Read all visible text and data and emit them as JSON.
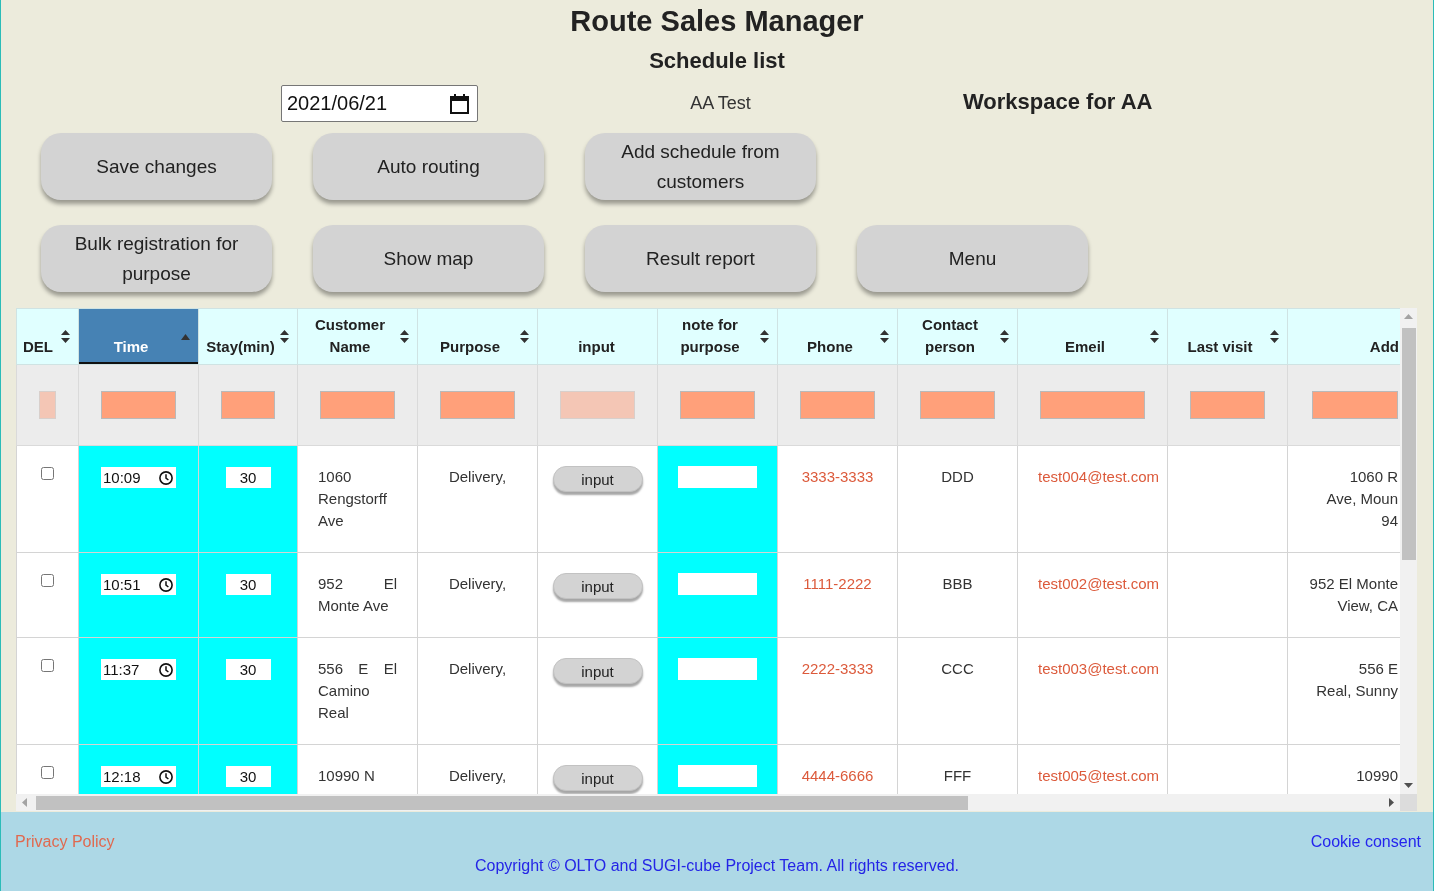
{
  "header": {
    "title": "Route Sales Manager",
    "subtitle": "Schedule list",
    "date_field": {
      "value": "2021/06/21"
    },
    "user": "AA Test",
    "workspace": "Workspace for AA"
  },
  "button_rows": [
    [
      "Save changes",
      "Auto routing",
      "Add schedule from customers"
    ],
    [
      "Bulk registration for purpose",
      "Show map",
      "Result report",
      "Menu"
    ]
  ],
  "table": {
    "columns": [
      {
        "kind": "del",
        "label": "DEL",
        "sortable": true,
        "sorted_ascending": false,
        "editable": false,
        "filter_disabled": true
      },
      {
        "kind": "time",
        "label": "Time",
        "sortable": true,
        "sorted_ascending": true,
        "editable": true,
        "filter_disabled": false
      },
      {
        "kind": "stay",
        "label": "Stay(min)",
        "sortable": true,
        "sorted_ascending": false,
        "editable": true,
        "filter_disabled": false
      },
      {
        "kind": "customer",
        "label": "Customer Name",
        "sortable": true,
        "sorted_ascending": false,
        "editable": false,
        "filter_disabled": false
      },
      {
        "kind": "purpose",
        "label": "Purpose",
        "sortable": true,
        "sorted_ascending": false,
        "editable": false,
        "filter_disabled": false
      },
      {
        "kind": "input",
        "label": "input",
        "sortable": false,
        "sorted_ascending": false,
        "editable": false,
        "filter_disabled": true
      },
      {
        "kind": "note",
        "label": "note for purpose",
        "sortable": true,
        "sorted_ascending": false,
        "editable": true,
        "filter_disabled": false
      },
      {
        "kind": "phone",
        "label": "Phone",
        "sortable": true,
        "sorted_ascending": false,
        "editable": false,
        "filter_disabled": false
      },
      {
        "kind": "contact",
        "label": "Contact person",
        "sortable": true,
        "sorted_ascending": false,
        "editable": false,
        "filter_disabled": false
      },
      {
        "kind": "email",
        "label": "Emeil",
        "sortable": true,
        "sorted_ascending": false,
        "editable": false,
        "filter_disabled": false
      },
      {
        "kind": "last_visit",
        "label": "Last visit",
        "sortable": true,
        "sorted_ascending": false,
        "editable": false,
        "filter_disabled": false
      },
      {
        "kind": "address",
        "label": "Add",
        "sortable": false,
        "sorted_ascending": false,
        "editable": false,
        "filter_disabled": false
      }
    ],
    "rows": [
      {
        "checked": false,
        "time": "10:09",
        "stay_min": "30",
        "customer_name": "1060 Rengstorff Ave",
        "purpose": "Delivery,",
        "input_button": "input",
        "phone": "3333-3333",
        "contact_person": "DDD",
        "email": "test004@test.com",
        "address": [
          "1060 R",
          "Ave, Moun",
          "94"
        ]
      },
      {
        "checked": false,
        "time": "10:51",
        "stay_min": "30",
        "customer_name": "952 El Monte Ave",
        "purpose": "Delivery,",
        "input_button": "input",
        "phone": "1111-2222",
        "contact_person": "BBB",
        "email": "test002@test.com",
        "address": [
          "952 El Monte",
          "View, CA"
        ]
      },
      {
        "checked": false,
        "time": "11:37",
        "stay_min": "30",
        "customer_name": "556 E El Camino Real",
        "purpose": "Delivery,",
        "input_button": "input",
        "phone": "2222-3333",
        "contact_person": "CCC",
        "email": "test003@test.com",
        "address": [
          "556 E",
          "Real, Sunny"
        ]
      },
      {
        "checked": false,
        "time": "12:18",
        "stay_min": "30",
        "customer_name": "10990 N",
        "purpose": "Delivery,",
        "input_button": "input",
        "phone": "4444-6666",
        "contact_person": "FFF",
        "email": "test005@test.com",
        "address": [
          "10990"
        ]
      }
    ]
  },
  "footer": {
    "privacy_link": "Privacy Policy",
    "cookie_link": "Cookie consent",
    "copyright": "Copyright © OLTO and SUGI-cube Project Team. All rights reserved."
  }
}
